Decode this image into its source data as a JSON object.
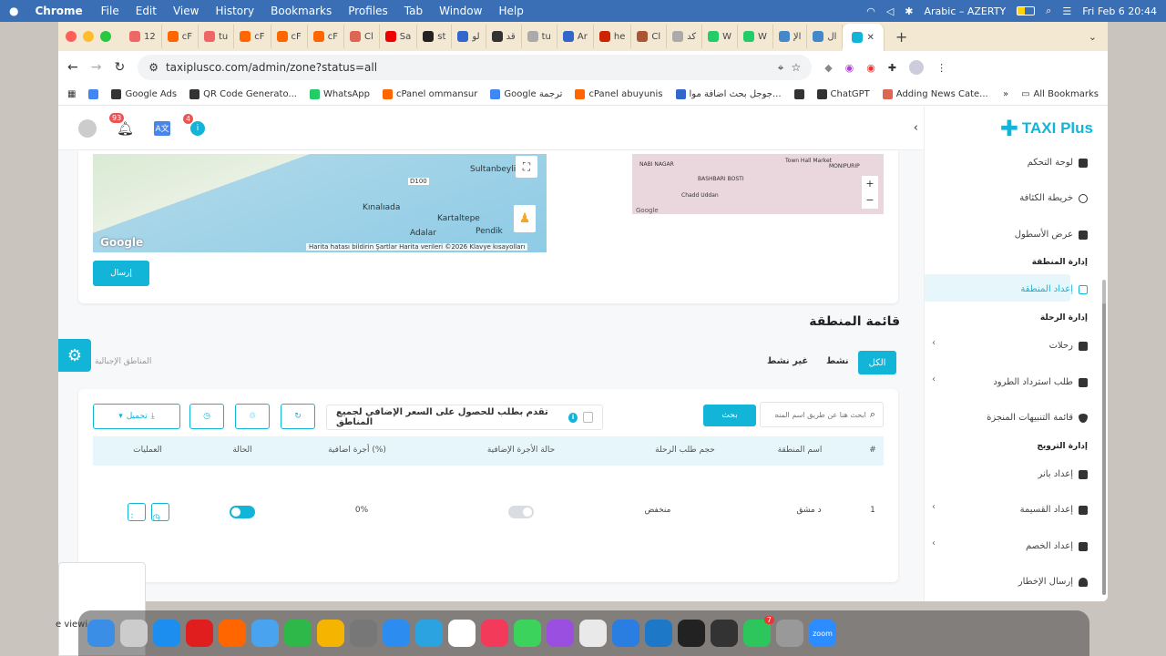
{
  "menubar": {
    "app": "Chrome",
    "items": [
      "File",
      "Edit",
      "View",
      "History",
      "Bookmarks",
      "Profiles",
      "Tab",
      "Window",
      "Help"
    ],
    "keyboard": "Arabic – AZERTY",
    "clock": "Fri Feb 6  20:44"
  },
  "tabs": [
    {
      "label": "12",
      "color": "#e66"
    },
    {
      "label": "cF",
      "color": "#f60"
    },
    {
      "label": "tu",
      "color": "#e66"
    },
    {
      "label": "cF",
      "color": "#f60"
    },
    {
      "label": "cF",
      "color": "#f60"
    },
    {
      "label": "cF",
      "color": "#f60"
    },
    {
      "label": "Cl",
      "color": "#d65"
    },
    {
      "label": "Sa",
      "color": "#e00"
    },
    {
      "label": "st",
      "color": "#222"
    },
    {
      "label": "لو",
      "color": "#36c"
    },
    {
      "label": "قد",
      "color": "#333"
    },
    {
      "label": "tu",
      "color": "#aaa"
    },
    {
      "label": "Ar",
      "color": "#36c"
    },
    {
      "label": "he",
      "color": "#c20"
    },
    {
      "label": "Cl",
      "color": "#a53"
    },
    {
      "label": "کد",
      "color": "#aaa"
    },
    {
      "label": "W",
      "color": "#2c6"
    },
    {
      "label": "W",
      "color": "#2c6"
    },
    {
      "label": "الإ",
      "color": "#48c"
    },
    {
      "label": "ال",
      "color": "#48c"
    }
  ],
  "address": {
    "url": "taxiplusco.com/admin/zone?status=all"
  },
  "bookmarks": [
    {
      "label": "",
      "color": "#4285f4"
    },
    {
      "label": "Google Ads",
      "color": "#333"
    },
    {
      "label": "QR Code Generato...",
      "color": "#333"
    },
    {
      "label": "WhatsApp",
      "color": "#2c6"
    },
    {
      "label": "cPanel  ommansur",
      "color": "#f60"
    },
    {
      "label": "Google ترجمة",
      "color": "#4285f4"
    },
    {
      "label": "cPanel abuyunis",
      "color": "#f60"
    },
    {
      "label": "جوجل بحث اضافة موا...",
      "color": "#36c"
    },
    {
      "label": "",
      "color": "#333"
    },
    {
      "label": "ChatGPT",
      "color": "#333"
    },
    {
      "label": "Adding News Cate...",
      "color": "#d65"
    }
  ],
  "all_bookmarks": "All Bookmarks",
  "topbar": {
    "notif_count": "93",
    "info_count": "4"
  },
  "brand": {
    "name": "TAXI Plus",
    "color": "#12b5d8"
  },
  "sidebar": {
    "dashboard": "لوحة التحكم",
    "heatmap": "خريطة الكثافة",
    "fleet": "عرض الأسطول",
    "hdr_zone": "إدارة المنطقة",
    "zone_setup": "إعداد المنطقة",
    "hdr_trip": "إدارة الرحلة",
    "trips": "رحلات",
    "parcel_return": "طلب استرداد الطرود",
    "safety_list": "قائمة التنبيهات المنجزة",
    "hdr_promo": "إدارة الترويج",
    "banner": "إعداد بانر",
    "coupon": "إعداد القسيمة",
    "discount": "إعداد الخصم",
    "notify": "إرسال الإخطار"
  },
  "map": {
    "labels": [
      "Sultanbeyli",
      "Kınalıada",
      "Kartaltepe",
      "Adalar",
      "Pendik",
      "D100"
    ],
    "attribution": "Harita hatası bildirin   Şartlar   Harita verileri ©2026   Klavye kısayolları",
    "logo": "Google",
    "small_labels": [
      "NABI NAGAR",
      "BASHBARI BOSTI",
      "Chadd Uddan",
      "Town Hall Market",
      "MONIPURIP"
    ]
  },
  "submit_label": "إرسال",
  "list_title": "قائمة المنطقة",
  "filters": {
    "all": "الكل",
    "active": "نشط",
    "inactive": "غير نشط"
  },
  "setup_guide": "المناطق الإجبالية",
  "search": {
    "placeholder": "ابحث هنا عن طريق اسم المنطقة",
    "button": "بحث"
  },
  "extra_fare_label": "تقدم بطلب للحصول على السعر الإضافي لجميع المناطق",
  "download_label": "تحميل",
  "table": {
    "headers": [
      "#",
      "اسم المنطقة",
      "حجم طلب الرحلة",
      "حالة الأجرة الإضافية",
      "أجرة اضافية (%)",
      "الحالة",
      "العمليات"
    ],
    "rows": [
      {
        "index": "1",
        "name": "د مشق",
        "volume": "منخفض",
        "extra_fare_status": false,
        "extra_fare": "0%",
        "status": true
      }
    ]
  },
  "dock_overlay_text": "e viewi",
  "dock": [
    {
      "name": "finder",
      "color": "#3a8ee6"
    },
    {
      "name": "launchpad",
      "color": "#ccc"
    },
    {
      "name": "app-store",
      "color": "#1b8ef0"
    },
    {
      "name": "opera",
      "color": "#e01e1e"
    },
    {
      "name": "firefox",
      "color": "#f60"
    },
    {
      "name": "mail",
      "color": "#4aa3ef"
    },
    {
      "name": "numbers",
      "color": "#2fb84a"
    },
    {
      "name": "photos",
      "color": "#f5b400"
    },
    {
      "name": "apps-grid",
      "color": "#777"
    },
    {
      "name": "safari",
      "color": "#2d8cf0"
    },
    {
      "name": "telegram",
      "color": "#2aa3e0"
    },
    {
      "name": "reminders",
      "color": "#fff"
    },
    {
      "name": "music",
      "color": "#f33a5a"
    },
    {
      "name": "messages",
      "color": "#3bd35b"
    },
    {
      "name": "podcasts",
      "color": "#9a4fe0"
    },
    {
      "name": "chrome",
      "color": "#e9e9e9"
    },
    {
      "name": "files",
      "color": "#2a7de1"
    },
    {
      "name": "vscode",
      "color": "#1e78c8"
    },
    {
      "name": "terminal",
      "color": "#222"
    },
    {
      "name": "activity",
      "color": "#333"
    },
    {
      "name": "whatsapp",
      "color": "#2cc65c",
      "badge": "7"
    },
    {
      "name": "preview",
      "color": "#999"
    },
    {
      "name": "zoom",
      "color": "#2d8cff",
      "label": "zoom"
    }
  ]
}
